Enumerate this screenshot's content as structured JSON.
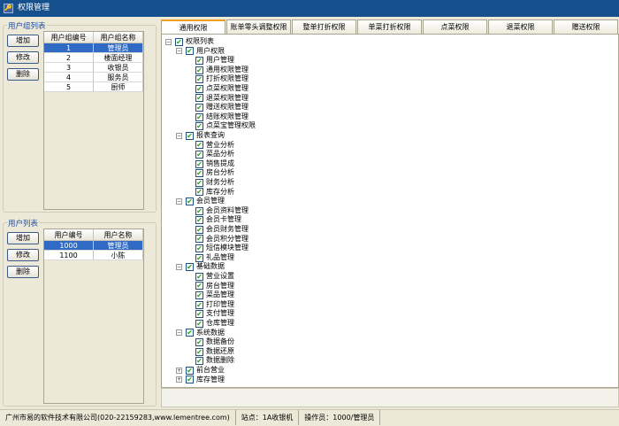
{
  "window": {
    "title": "权限管理"
  },
  "group_panel": {
    "title": "用户组列表",
    "buttons": [
      "增加",
      "修改",
      "删除"
    ],
    "columns": [
      "用户组编号",
      "用户组名称"
    ],
    "rows": [
      [
        "1",
        "管理员"
      ],
      [
        "2",
        "楼面经理"
      ],
      [
        "3",
        "收银员"
      ],
      [
        "4",
        "服务员"
      ],
      [
        "5",
        "厨师"
      ]
    ],
    "selected": 0
  },
  "user_panel": {
    "title": "用户列表",
    "buttons": [
      "增加",
      "修改",
      "删除"
    ],
    "columns": [
      "用户编号",
      "用户名称"
    ],
    "rows": [
      [
        "1000",
        "管理员"
      ],
      [
        "1100",
        "小陈"
      ]
    ],
    "selected": 0
  },
  "tabs": [
    "通用权限",
    "账单零头调整权限",
    "整单打折权限",
    "单菜打折权限",
    "点菜权限",
    "退菜权限",
    "赠送权限"
  ],
  "active_tab": 0,
  "tree": {
    "root": "权限列表",
    "groups": [
      {
        "label": "用户权限",
        "expanded": true,
        "items": [
          "用户管理",
          "通用权限管理",
          "打折权限管理",
          "点菜权限管理",
          "退菜权限管理",
          "赠送权限管理",
          "结账权限管理",
          "点菜宝管理权限"
        ]
      },
      {
        "label": "报表查询",
        "expanded": true,
        "items": [
          "营业分析",
          "菜品分析",
          "销售提成",
          "房台分析",
          "财务分析",
          "库存分析"
        ]
      },
      {
        "label": "会员管理",
        "expanded": true,
        "items": [
          "会员资料管理",
          "会员卡管理",
          "会员财务管理",
          "会员积分管理",
          "短信模块管理",
          "礼品管理"
        ]
      },
      {
        "label": "基础数据",
        "expanded": true,
        "items": [
          "营业设置",
          "房台管理",
          "菜品管理",
          "打印管理",
          "支付管理",
          "仓库管理"
        ]
      },
      {
        "label": "系统数据",
        "expanded": true,
        "items": [
          "数据备份",
          "数据还原",
          "数据删除"
        ]
      },
      {
        "label": "前台营业",
        "expanded": false,
        "items": []
      },
      {
        "label": "库存管理",
        "expanded": false,
        "items": []
      }
    ]
  },
  "status": {
    "company": "广州市易的软件技术有限公司(020-22159283,www.lementree.com)",
    "station": "站点：1A收银机",
    "operator": "操作员：1000/管理员"
  }
}
